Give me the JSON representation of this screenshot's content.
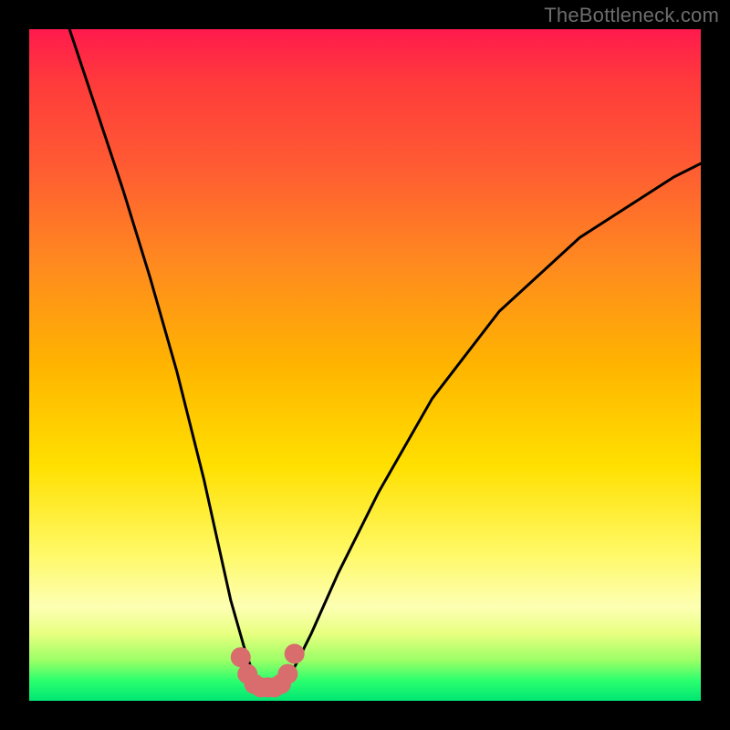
{
  "watermark": "TheBottleneck.com",
  "colors": {
    "frame": "#000000",
    "curve": "#000000",
    "marker": "#d96d6d",
    "gradient_top": "#ff1a4d",
    "gradient_bottom": "#00e673"
  },
  "chart_data": {
    "type": "line",
    "title": "",
    "xlabel": "",
    "ylabel": "",
    "xlim": [
      0,
      100
    ],
    "ylim": [
      0,
      100
    ],
    "grid": false,
    "legend": false,
    "series": [
      {
        "name": "bottleneck-curve",
        "x": [
          6,
          10,
          14,
          18,
          22,
          26,
          28,
          30,
          32,
          33,
          34,
          35,
          36,
          37,
          38,
          39,
          40,
          42,
          46,
          52,
          60,
          70,
          82,
          96,
          100
        ],
        "y": [
          100,
          88,
          76,
          63,
          49,
          33,
          24,
          15,
          8,
          5,
          3,
          2,
          2,
          2,
          3,
          4,
          6,
          10,
          19,
          31,
          45,
          58,
          69,
          78,
          80
        ]
      }
    ],
    "markers": {
      "name": "highlighted-region",
      "x": [
        31.5,
        32.5,
        33.5,
        34.5,
        35.5,
        36.5,
        37.5,
        38.5,
        39.5
      ],
      "y": [
        6.5,
        4,
        2.5,
        2,
        2,
        2,
        2.5,
        4,
        7
      ]
    }
  }
}
